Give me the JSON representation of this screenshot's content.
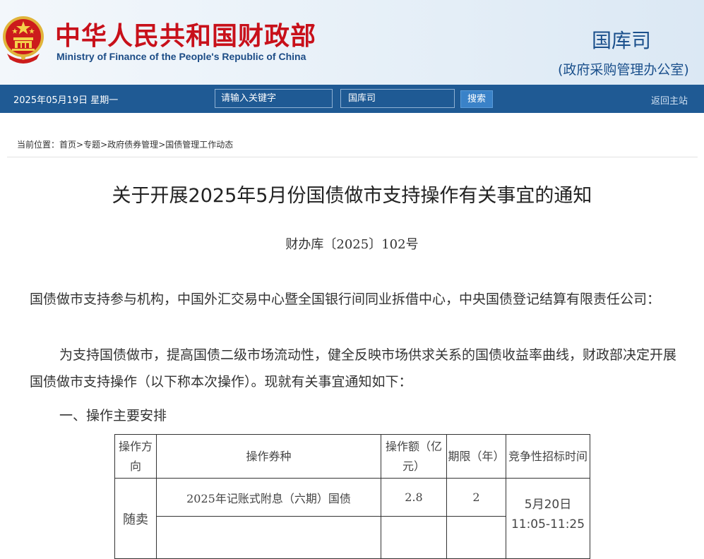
{
  "header": {
    "site_title": "中华人民共和国财政部",
    "site_subtitle": "Ministry of Finance of the People's Republic of China",
    "dept_name": "国库司",
    "dept_sub": "(政府采购管理办公室)",
    "emblem_icon": "national-emblem-icon"
  },
  "navbar": {
    "date": "2025年05月19日  星期一",
    "search_placeholder": "请输入关键字",
    "scope_value": "国库司",
    "search_button": "搜索",
    "home_link": "返回主站"
  },
  "breadcrumb": {
    "label": "当前位置：",
    "items": [
      "首页",
      "专题",
      "政府债券管理",
      "国债管理工作动态"
    ],
    "separator": ">"
  },
  "article": {
    "title": "关于开展2025年5月份国债做市支持操作有关事宜的通知",
    "doc_number": "财办库〔2025〕102号",
    "addressee": "国债做市支持参与机构，中国外汇交易中心暨全国银行间同业拆借中心，中央国债登记结算有限责任公司：",
    "intro": "为支持国债做市，提高国债二级市场流动性，健全反映市场供求关系的国债收益率曲线，财政部决定开展国债做市支持操作（以下称本次操作）。现就有关事宜通知如下：",
    "section_1": "一、操作主要安排"
  },
  "table": {
    "headers": [
      "操作方向",
      "操作券种",
      "操作额（亿元）",
      "期限（年）",
      "竞争性招标时间"
    ],
    "rows": [
      {
        "direction": "随卖",
        "bond": "2025年记账式附息（六期）国债",
        "amount": "2.8",
        "term": "2",
        "time_date": "5月20日",
        "time_range": "11:05-11:25"
      },
      {
        "bond": "",
        "amount": "",
        "term": ""
      }
    ]
  },
  "colors": {
    "title_red": "#c8101a",
    "nav_blue": "#1f5a94",
    "accent_blue": "#1b508c",
    "button_blue": "#3a82c8"
  }
}
